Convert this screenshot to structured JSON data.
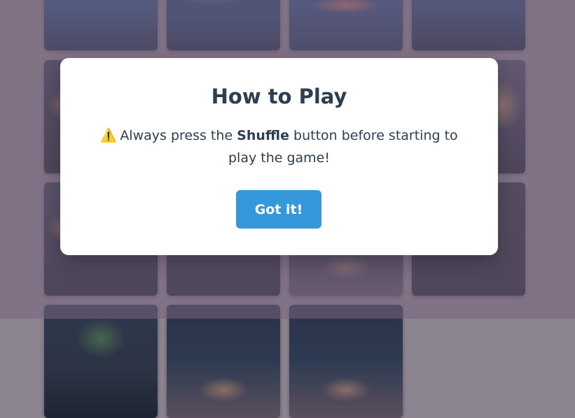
{
  "modal": {
    "title": "How to Play",
    "warning_icon": "⚠️",
    "message_before": "Always press the ",
    "message_bold": "Shuffle",
    "message_after": " button before starting to play the game!",
    "button_label": "Got it!"
  },
  "colors": {
    "accent": "#3498db",
    "text": "#2c3e50",
    "overlay": "#8d8491"
  },
  "tiles": [
    {
      "style": "t-sky1"
    },
    {
      "style": "t-sky2"
    },
    {
      "style": "t-sky3"
    },
    {
      "style": "t-sky4"
    },
    {
      "style": "t-street"
    },
    {
      "style": "t-sky2"
    },
    {
      "style": "t-sky3"
    },
    {
      "style": "t-house"
    },
    {
      "style": "t-street"
    },
    {
      "style": "t-green"
    },
    {
      "style": "t-road"
    },
    {
      "style": "t-dark"
    },
    {
      "style": "t-green"
    },
    {
      "style": "t-road"
    },
    {
      "style": "t-road"
    }
  ]
}
